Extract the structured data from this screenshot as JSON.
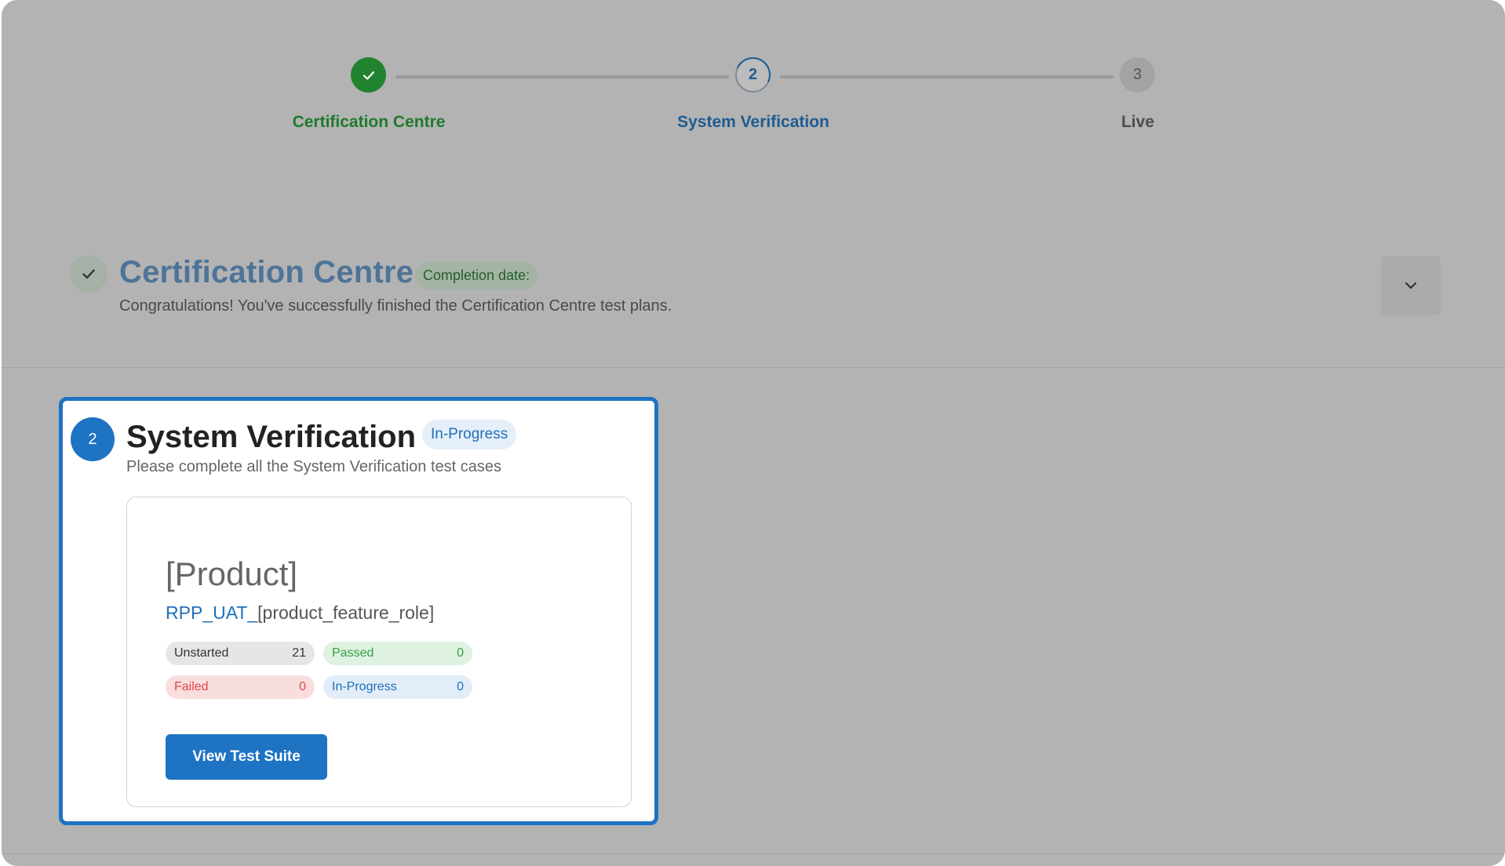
{
  "stepper": {
    "steps": [
      {
        "number": "1",
        "label": "Certification Centre",
        "state": "complete",
        "icon": "check-icon"
      },
      {
        "number": "2",
        "label": "System Verification",
        "state": "in-progress"
      },
      {
        "number": "3",
        "label": "Live",
        "state": "upcoming"
      }
    ]
  },
  "certification": {
    "title": "Certification Centre",
    "badge": "Completion date:",
    "description": "Congratulations! You've successfully finished the Certification Centre test plans.",
    "status_icon": "check-icon",
    "toggle_icon": "chevron-down-icon"
  },
  "system_verification": {
    "number": "2",
    "title": "System Verification",
    "badge": "In-Progress",
    "description": "Please complete all the System Verification test cases",
    "suite": {
      "product": "[Product]",
      "code_prefix": "RPP_UAT_",
      "code_suffix": "[product_feature_role]",
      "stats": {
        "unstarted": {
          "label": "Unstarted",
          "count": "21"
        },
        "passed": {
          "label": "Passed",
          "count": "0"
        },
        "failed": {
          "label": "Failed",
          "count": "0"
        },
        "in_progress": {
          "label": "In-Progress",
          "count": "0"
        }
      },
      "button_label": "View Test Suite"
    }
  },
  "colors": {
    "complete_green": "#21822f",
    "primary_blue": "#1e73c3",
    "overlay_gray": "#b3b3b3"
  }
}
